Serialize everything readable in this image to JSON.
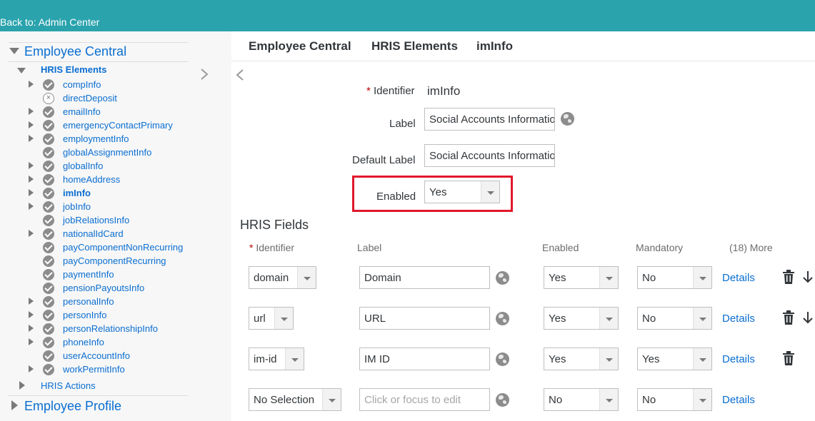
{
  "topbar": {
    "back_link": "Back to: Admin Center"
  },
  "breadcrumb": [
    "Employee Central",
    "HRIS Elements",
    "imInfo"
  ],
  "tree": {
    "root": "Employee Central",
    "sub": "HRIS Elements",
    "items": [
      {
        "label": "compInfo",
        "status": "ok",
        "expandable": true
      },
      {
        "label": "directDeposit",
        "status": "disabled",
        "expandable": false
      },
      {
        "label": "emailInfo",
        "status": "ok",
        "expandable": true
      },
      {
        "label": "emergencyContactPrimary",
        "status": "ok",
        "expandable": true
      },
      {
        "label": "employmentInfo",
        "status": "ok",
        "expandable": true
      },
      {
        "label": "globalAssignmentInfo",
        "status": "ok",
        "expandable": false
      },
      {
        "label": "globalInfo",
        "status": "ok",
        "expandable": true
      },
      {
        "label": "homeAddress",
        "status": "ok",
        "expandable": true
      },
      {
        "label": "imInfo",
        "status": "ok",
        "expandable": true
      },
      {
        "label": "jobInfo",
        "status": "ok",
        "expandable": true
      },
      {
        "label": "jobRelationsInfo",
        "status": "ok",
        "expandable": false
      },
      {
        "label": "nationalIdCard",
        "status": "ok",
        "expandable": true
      },
      {
        "label": "payComponentNonRecurring",
        "status": "ok",
        "expandable": false
      },
      {
        "label": "payComponentRecurring",
        "status": "ok",
        "expandable": false
      },
      {
        "label": "paymentInfo",
        "status": "ok",
        "expandable": false
      },
      {
        "label": "pensionPayoutsInfo",
        "status": "ok",
        "expandable": false
      },
      {
        "label": "personalInfo",
        "status": "ok",
        "expandable": true
      },
      {
        "label": "personInfo",
        "status": "ok",
        "expandable": true
      },
      {
        "label": "personRelationshipInfo",
        "status": "ok",
        "expandable": true
      },
      {
        "label": "phoneInfo",
        "status": "ok",
        "expandable": true
      },
      {
        "label": "userAccountInfo",
        "status": "ok",
        "expandable": false
      },
      {
        "label": "workPermitInfo",
        "status": "ok",
        "expandable": true
      }
    ],
    "actions": "HRIS Actions",
    "next_root": "Employee Profile"
  },
  "form": {
    "required_mark": "*",
    "identifier_label": "Identifier",
    "identifier_value": "imInfo",
    "label_label": "Label",
    "label_value": "Social Accounts Information",
    "default_label_label": "Default Label",
    "default_label_value": "Social Accounts Information",
    "enabled_label": "Enabled",
    "enabled_value": "Yes"
  },
  "fields": {
    "title": "HRIS Fields",
    "headers": {
      "identifier": "Identifier",
      "label": "Label",
      "enabled": "Enabled",
      "mandatory": "Mandatory",
      "more": "(18) More"
    },
    "rows": [
      {
        "identifier": "domain",
        "label": "Domain",
        "placeholder": false,
        "enabled": "Yes",
        "mandatory": "No",
        "details": "Details"
      },
      {
        "identifier": "url",
        "label": "URL",
        "placeholder": false,
        "enabled": "Yes",
        "mandatory": "No",
        "details": "Details"
      },
      {
        "identifier": "im-id",
        "label": "IM ID",
        "placeholder": false,
        "enabled": "Yes",
        "mandatory": "Yes",
        "details": "Details"
      },
      {
        "identifier": "No Selection",
        "label": "Click or focus to edit",
        "placeholder": true,
        "enabled": "No",
        "mandatory": "No",
        "details": "Details"
      }
    ]
  },
  "colors": {
    "topbar": "#2aa3ad",
    "link": "#0a6ed1",
    "highlight": "#e0182b"
  }
}
